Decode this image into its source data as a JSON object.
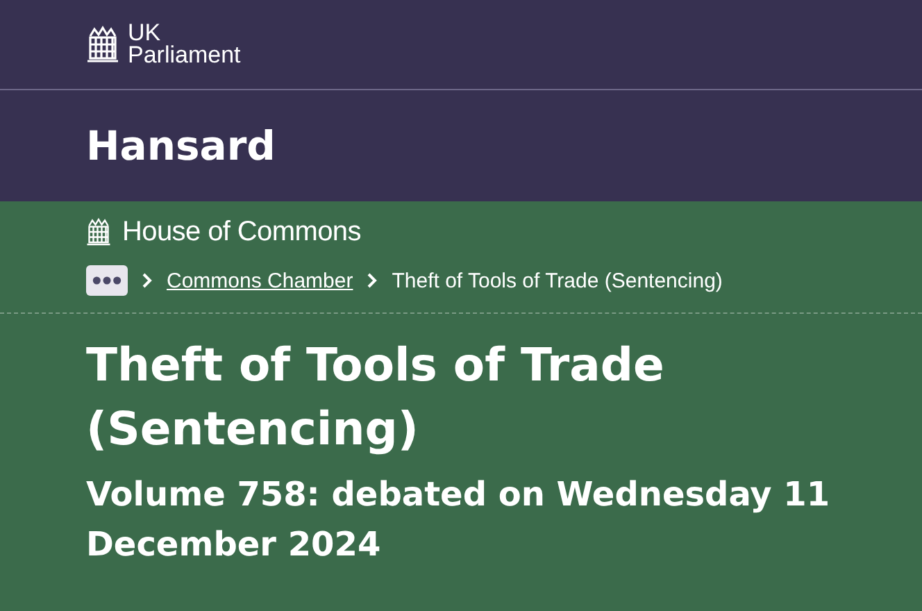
{
  "brand": {
    "line_1": "UK",
    "line_2": "Parliament"
  },
  "section": {
    "title": "Hansard"
  },
  "house": {
    "name": "House of Commons"
  },
  "breadcrumbs": [
    {
      "label": "Commons Chamber",
      "kind": "link"
    },
    {
      "label": "Theft of Tools of Trade (Sentencing)",
      "kind": "current"
    }
  ],
  "debate": {
    "title": "Theft of Tools of Trade (Sentencing)",
    "subtitle": "Volume 758: debated on Wednesday 11 December 2024"
  }
}
